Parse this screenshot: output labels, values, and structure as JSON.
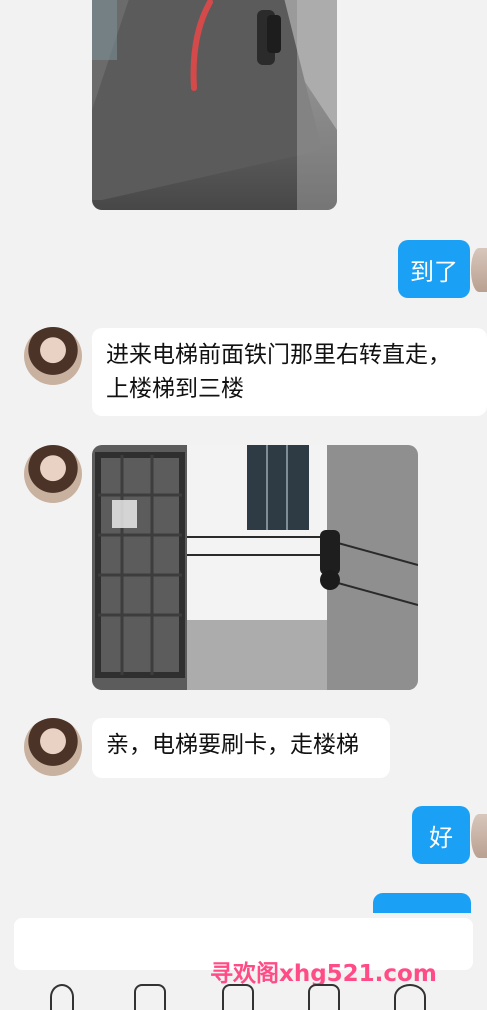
{
  "chat": {
    "messages": [
      {
        "type": "incoming_text",
        "text": "进来电梯前面铁门那里右转直走，上楼梯到三楼"
      },
      {
        "type": "incoming_text",
        "text": "亲，电梯要刷卡，走楼梯"
      }
    ],
    "outgoing": [
      {
        "text": "到了"
      },
      {
        "text": "好"
      }
    ]
  },
  "watermark": {
    "text": "寻欢阁xhg521.com"
  },
  "colors": {
    "accent": "#1aa0f5",
    "background": "#f2f2f2",
    "bubble_incoming": "#ffffff",
    "watermark": "#ff4b86"
  },
  "icons": {
    "bottom_bar": [
      "voice-icon",
      "image-icon",
      "camera-icon",
      "file-icon",
      "emoji-icon"
    ]
  }
}
